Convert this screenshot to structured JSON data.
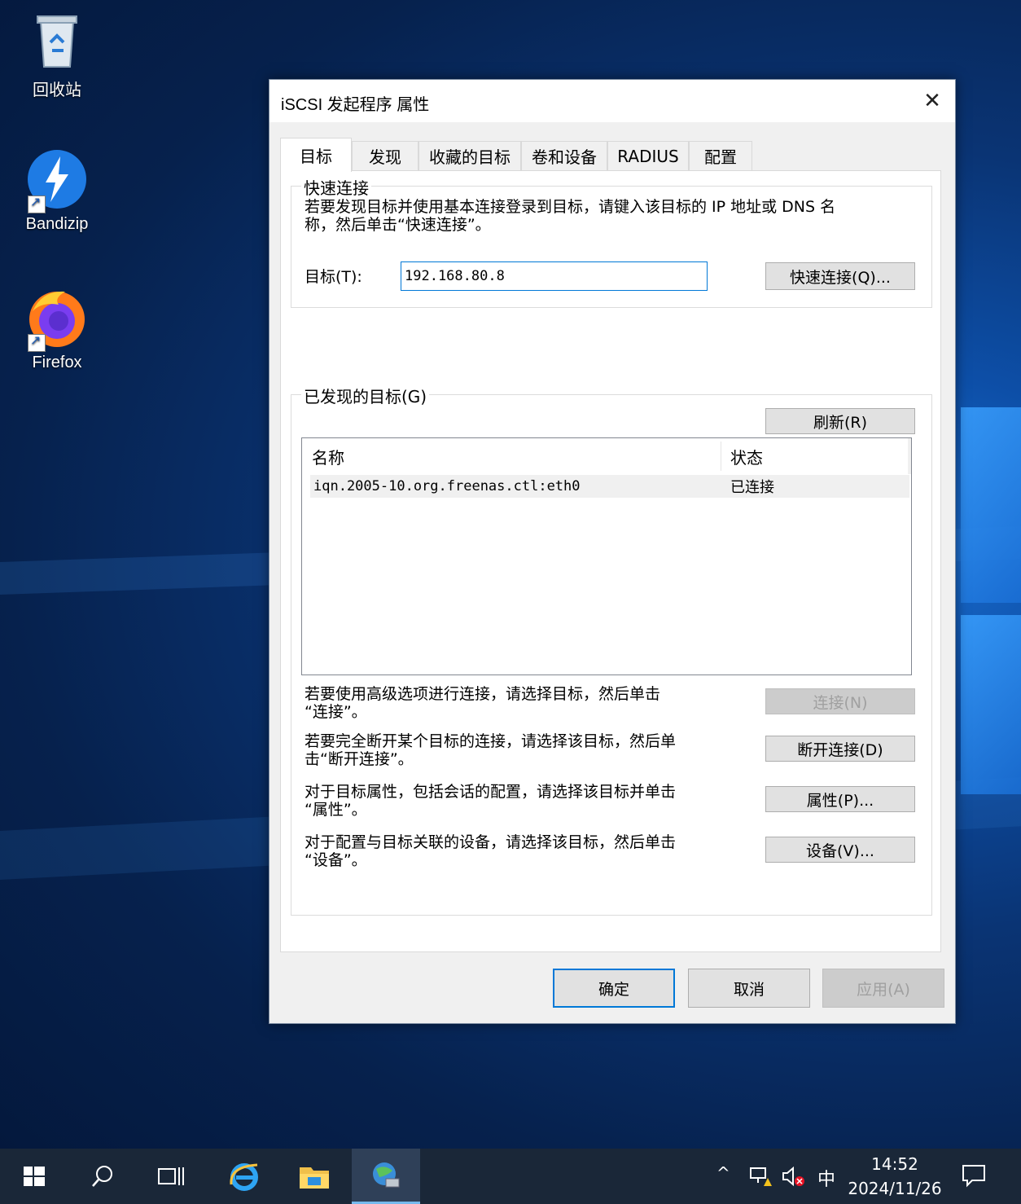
{
  "desktop": {
    "icons": [
      {
        "label": "回收站",
        "icon": "recycle-bin-icon"
      },
      {
        "label": "Bandizip",
        "icon": "bandizip-icon"
      },
      {
        "label": "Firefox",
        "icon": "firefox-icon"
      }
    ]
  },
  "dialog": {
    "title": "iSCSI 发起程序 属性",
    "close_glyph": "✕",
    "tabs": [
      {
        "label": "目标",
        "active": true
      },
      {
        "label": "发现"
      },
      {
        "label": "收藏的目标"
      },
      {
        "label": "卷和设备"
      },
      {
        "label": "RADIUS"
      },
      {
        "label": "配置"
      }
    ],
    "quick_connect": {
      "group_label": "快速连接",
      "description_line1": "若要发现目标并使用基本连接登录到目标，请键入该目标的 IP 地址或 DNS 名",
      "description_line2": "称，然后单击“快速连接”。",
      "target_label": "目标(T):",
      "target_value": "192.168.80.8",
      "button_label": "快速连接(Q)..."
    },
    "discovered": {
      "group_label": "已发现的目标(G)",
      "refresh_label": "刷新(R)",
      "columns": [
        "名称",
        "状态"
      ],
      "rows": [
        {
          "name": "iqn.2005-10.org.freenas.ctl:eth0",
          "status": "已连接"
        }
      ]
    },
    "actions": [
      {
        "line1": "若要使用高级选项进行连接，请选择目标，然后单击",
        "line2": "“连接”。",
        "button": "连接(N)",
        "disabled": true
      },
      {
        "line1": "若要完全断开某个目标的连接，请选择该目标，然后单",
        "line2": "击“断开连接”。",
        "button": "断开连接(D)"
      },
      {
        "line1": "对于目标属性，包括会话的配置，请选择该目标并单击",
        "line2": "“属性”。",
        "button": "属性(P)..."
      },
      {
        "line1": "对于配置与目标关联的设备，请选择该目标，然后单击",
        "line2": "“设备”。",
        "button": "设备(V)..."
      }
    ],
    "footer": {
      "ok": "确定",
      "cancel": "取消",
      "apply": "应用(A)"
    }
  },
  "taskbar": {
    "items": [
      "start-icon",
      "search-icon",
      "task-view-icon",
      "internet-explorer-icon",
      "file-explorer-icon",
      "iscsi-initiator-icon"
    ],
    "ime": "中",
    "time": "14:52",
    "date": "2024/11/26"
  }
}
